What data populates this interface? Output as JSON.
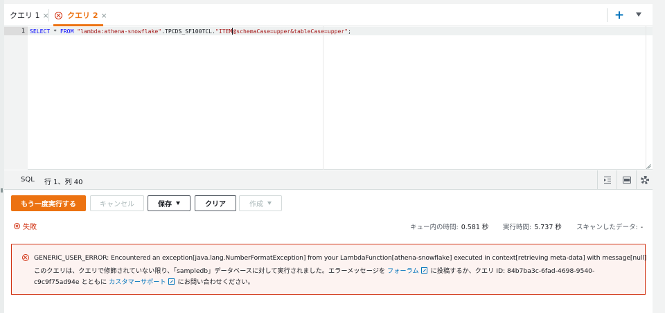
{
  "tabs": {
    "items": [
      {
        "label": "クエリ 1",
        "close": "×"
      },
      {
        "label": "クエリ 2",
        "close": "×"
      }
    ],
    "add_label": "+"
  },
  "editor": {
    "line_number": "1",
    "code": {
      "kw1": "SELECT",
      "mid1": " * ",
      "kw2": "FROM",
      "sp": " ",
      "str1": "\"lambda:athena-snowflake\"",
      "mid2": ".TPCDS_SF100TCL.",
      "str2a": "\"ITEM",
      "str2b": "@schemaCase=upper&tableCase=upper\"",
      "end": ";"
    }
  },
  "status_bar": {
    "language": "SQL",
    "position": "行 1、列 40"
  },
  "actions": {
    "run": "もう一度実行する",
    "cancel": "キャンセル",
    "save": "保存",
    "clear": "クリア",
    "create": "作成"
  },
  "result": {
    "status": "失敗",
    "queue_time_label": "キュー内の時間:",
    "queue_time_value": "0.581 秒",
    "run_time_label": "実行時間:",
    "run_time_value": "5.737 秒",
    "scanned_label": "スキャンしたデータ:",
    "scanned_value": "-"
  },
  "error": {
    "title": "GENERIC_USER_ERROR: Encountered an exception[java.lang.NumberFormatException] from your LambdaFunction[athena-snowflake] executed in context[retrieving meta-data] with message[null]",
    "body_1": "このクエリは、クエリで修飾されていない限り、「sampledb」データベースに対して実行されました。エラーメッセージを ",
    "link_forum": "フォーラム",
    "body_2": " に投稿するか、クエリ ID: 84b7ba3c-6fad-4698-9540-c9c9f75ad94e とともに ",
    "link_support": "カスタマーサポート",
    "body_3": " にお問い合わせください。"
  },
  "colors": {
    "accent": "#ec7211",
    "error": "#d13212",
    "link": "#0073bb"
  }
}
